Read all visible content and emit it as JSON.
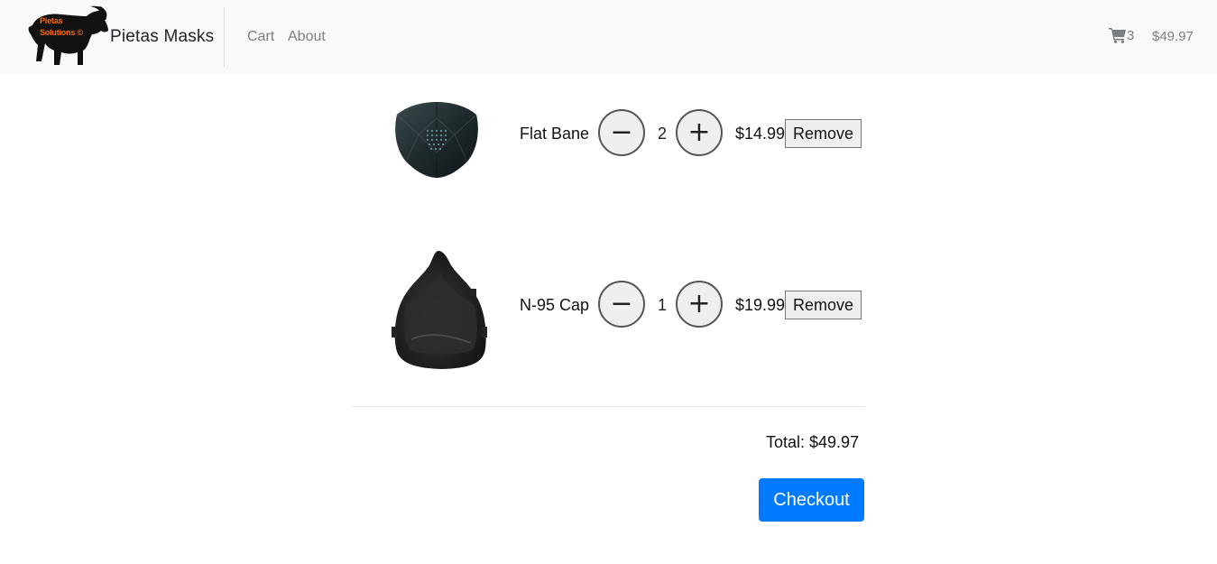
{
  "brand": {
    "logo_text_line1": "Pietas",
    "logo_text_line2": "Solutions ©",
    "name": "Pietas Masks"
  },
  "nav": {
    "links": [
      {
        "label": "Cart"
      },
      {
        "label": "About"
      }
    ]
  },
  "cart_summary": {
    "icon": "shopping-cart-icon",
    "count": "3",
    "total": "$49.97"
  },
  "items": [
    {
      "name": "Flat Bane",
      "image": "flat-bane-mask",
      "decrement": "−",
      "quantity": "2",
      "increment": "+",
      "price": "$14.99",
      "remove_label": "Remove"
    },
    {
      "name": "N-95 Cap",
      "image": "n95-cap-mask",
      "decrement": "−",
      "quantity": "1",
      "increment": "+",
      "price": "$19.99",
      "remove_label": "Remove"
    }
  ],
  "summary": {
    "total_label": "Total: $49.97",
    "checkout_label": "Checkout"
  },
  "colors": {
    "navbar_bg": "#f8f9fa",
    "primary": "#007bff",
    "logo_text": "#ff6a00"
  }
}
